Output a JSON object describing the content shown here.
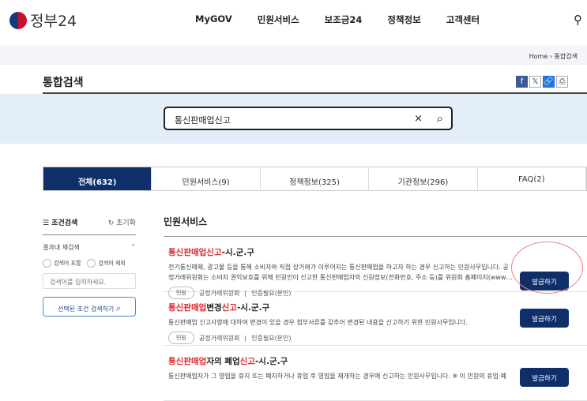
{
  "header": {
    "logo_text": "정부24",
    "nav": [
      "MyGOV",
      "민원서비스",
      "보조금24",
      "정책정보",
      "고객센터"
    ]
  },
  "breadcrumb": {
    "home": "Home",
    "sep": "›",
    "current": "통합검색"
  },
  "page_title": "통합검색",
  "share": {
    "facebook": "f",
    "x": "𝕏",
    "link": "🔗",
    "print": "⎙"
  },
  "search": {
    "value": "통신판매업신고",
    "clear": "×",
    "icon": "⌕"
  },
  "tabs": [
    "전체(632)",
    "민원서비스(9)",
    "정책정보(325)",
    "기관정보(296)",
    "FAQ(2)"
  ],
  "sidebar": {
    "title": "조건검색",
    "reset": "초기화",
    "section": "결과내 재검색",
    "options": [
      "검색어 포함",
      "검색어 제외"
    ],
    "placeholder": "검색어를 입력하세요.",
    "button": "선택된 조건 검색하기"
  },
  "main": {
    "section_title": "민원서비스",
    "button_label": "발급하기",
    "items": [
      {
        "title_parts": [
          "통신판매업신고",
          "-시.군.구"
        ],
        "desc1": "전기통신매체, 광고물 등을 통해 소비자와 직접 상거래가 이루어지는 통신판매업을 하고자 하는 경우 신고하는 민원사무입니다. 공",
        "desc2": "정거래위원회는 소비자 권익보호를 위해 민원인이 신고한 통신판매업자의 신원정보(전화번호, 주소 등)를 위원회 홈페이지(www…",
        "chip": "민원",
        "org": "공정거래위원회",
        "auth": "인증필요(본인)"
      },
      {
        "title_parts": [
          "통신판매업",
          "변경",
          "신고",
          "-시.군.구"
        ],
        "desc1": "통신판매업 신고사항에 대하여 변경이 있을 경우 첨부서류를 갖추어 변경된 내용을 신고하기 위한 민원사무입니다.",
        "chip": "민원",
        "org": "공정거래위원회",
        "auth": "인증필요(본인)"
      },
      {
        "title_parts": [
          "통신판매업",
          "자의 폐업",
          "신고",
          "-시.군.구"
        ],
        "desc1": "통신판매업자가 그 영업을 휴지 또는 폐지하거나 휴업 후 영업을 재개하는 경우에 신고하는 민원사무입니다. ※ 이 민원의 휴업·폐"
      }
    ]
  }
}
